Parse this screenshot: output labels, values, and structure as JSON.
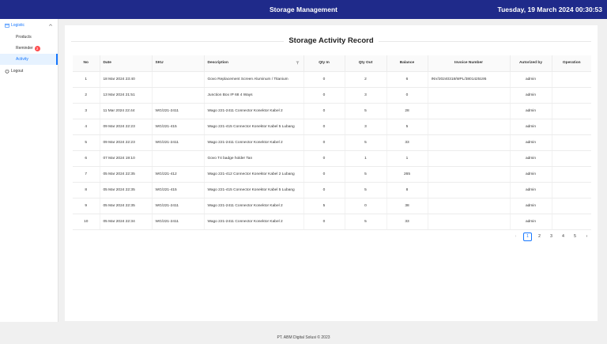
{
  "header": {
    "title": "Storage Management",
    "datetime": "Tuesday, 19 March 2024 00:30:53"
  },
  "sidebar": {
    "group_label": "Logistic",
    "items": [
      {
        "label": "Products"
      },
      {
        "label": "Reminder",
        "badge": "2"
      },
      {
        "label": "Activity"
      }
    ],
    "logout_label": "Logout"
  },
  "main": {
    "title": "Storage Activity Record",
    "columns": [
      "No",
      "Date",
      "SKU",
      "Description",
      "Qty In",
      "Qty Out",
      "Balance",
      "Invoice Number",
      "Autorized by",
      "Operation"
    ],
    "rows": [
      [
        "1",
        "18 Mar 2024 23:40",
        "",
        "Govo Replacement Screen Aluminum / Titanium",
        "0",
        "2",
        "6",
        "INV/20240318/MPL/3801425195",
        "admin",
        ""
      ],
      [
        "2",
        "13 Mar 2024 21:51",
        "",
        "Junction Box IP 68 4 Ways",
        "0",
        "3",
        "0",
        "",
        "admin",
        ""
      ],
      [
        "3",
        "11 Mar 2024 22:44",
        "WG/221-2411",
        "Wago 221-2411 Connector Konektor Kabel 2",
        "0",
        "5",
        "28",
        "",
        "admin",
        ""
      ],
      [
        "4",
        "09 Mar 2024 22:23",
        "WG/221-415",
        "Wago 221-415 Connector Konektor Kabel 5 Lubang",
        "0",
        "3",
        "5",
        "",
        "admin",
        ""
      ],
      [
        "5",
        "09 Mar 2024 22:23",
        "WG/221-2411",
        "Wago 221-2411 Connector Konektor Kabel 2",
        "0",
        "5",
        "33",
        "",
        "admin",
        ""
      ],
      [
        "6",
        "07 Mar 2024 19:10",
        "",
        "Govo T4 badge holder Tan",
        "0",
        "1",
        "1",
        "",
        "admin",
        ""
      ],
      [
        "7",
        "05 Mar 2024 22:35",
        "WG/221-412",
        "Wago 221-412 Connector Konektor Kabel 2 Lubang",
        "0",
        "5",
        "265",
        "",
        "admin",
        ""
      ],
      [
        "8",
        "05 Mar 2024 22:35",
        "WG/221-415",
        "Wago 221-415 Connector Konektor Kabel 5 Lubang",
        "0",
        "5",
        "8",
        "",
        "admin",
        ""
      ],
      [
        "9",
        "05 Mar 2024 22:35",
        "WG/221-2411",
        "Wago 221-2411 Connector Konektor Kabel 2",
        "5",
        "0",
        "38",
        "",
        "admin",
        ""
      ],
      [
        "10",
        "05 Mar 2024 22:34",
        "WG/221-2411",
        "Wago 221-2411 Connector Konektor Kabel 2",
        "0",
        "5",
        "33",
        "",
        "admin",
        ""
      ]
    ]
  },
  "pagination": {
    "prev": "‹",
    "pages": [
      "1",
      "2",
      "3",
      "4",
      "5"
    ],
    "current": "1",
    "next": "›"
  },
  "footer": {
    "text": "PT. ABM Digital Solusi © 2023"
  },
  "colors": {
    "header_bg": "#1f2a8a",
    "accent": "#1677ff",
    "badge": "#ff4d4f"
  }
}
